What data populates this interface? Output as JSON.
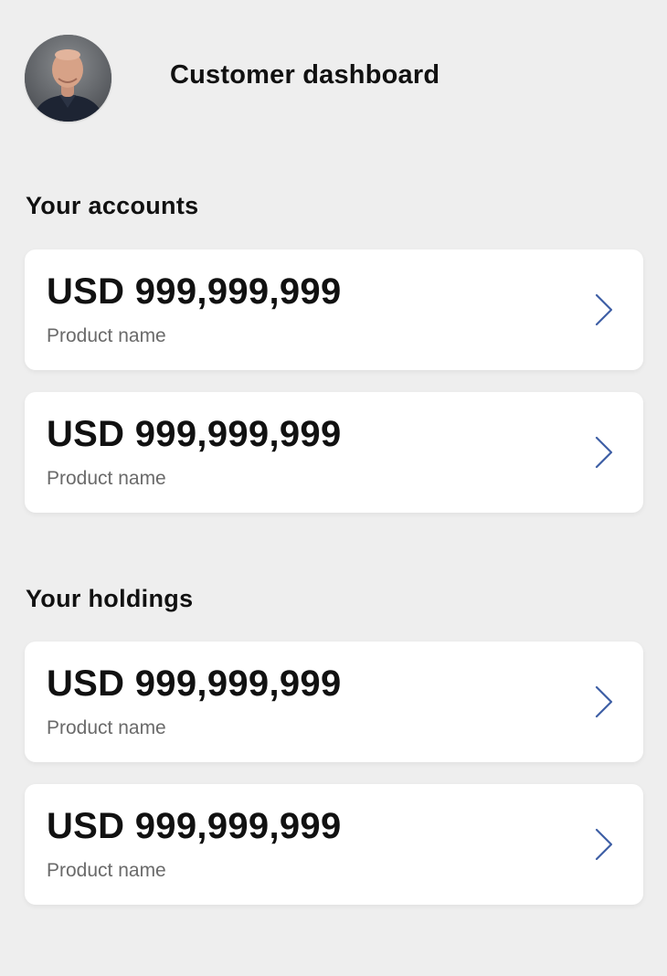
{
  "header": {
    "title": "Customer dashboard",
    "avatar_icon": "user-avatar-photo"
  },
  "accounts": {
    "title": "Your accounts",
    "items": [
      {
        "amount": "USD 999,999,999",
        "product": "Product name",
        "icon": "chevron-right-icon"
      },
      {
        "amount": "USD 999,999,999",
        "product": "Product name",
        "icon": "chevron-right-icon"
      }
    ]
  },
  "holdings": {
    "title": "Your holdings",
    "items": [
      {
        "amount": "USD 999,999,999",
        "product": "Product name",
        "icon": "chevron-right-icon"
      },
      {
        "amount": "USD 999,999,999",
        "product": "Product name",
        "icon": "chevron-right-icon"
      }
    ]
  },
  "colors": {
    "background": "#eeeeee",
    "card": "#ffffff",
    "text": "#111111",
    "muted_text": "#6a6a6a",
    "chevron": "#3e5fa5"
  }
}
